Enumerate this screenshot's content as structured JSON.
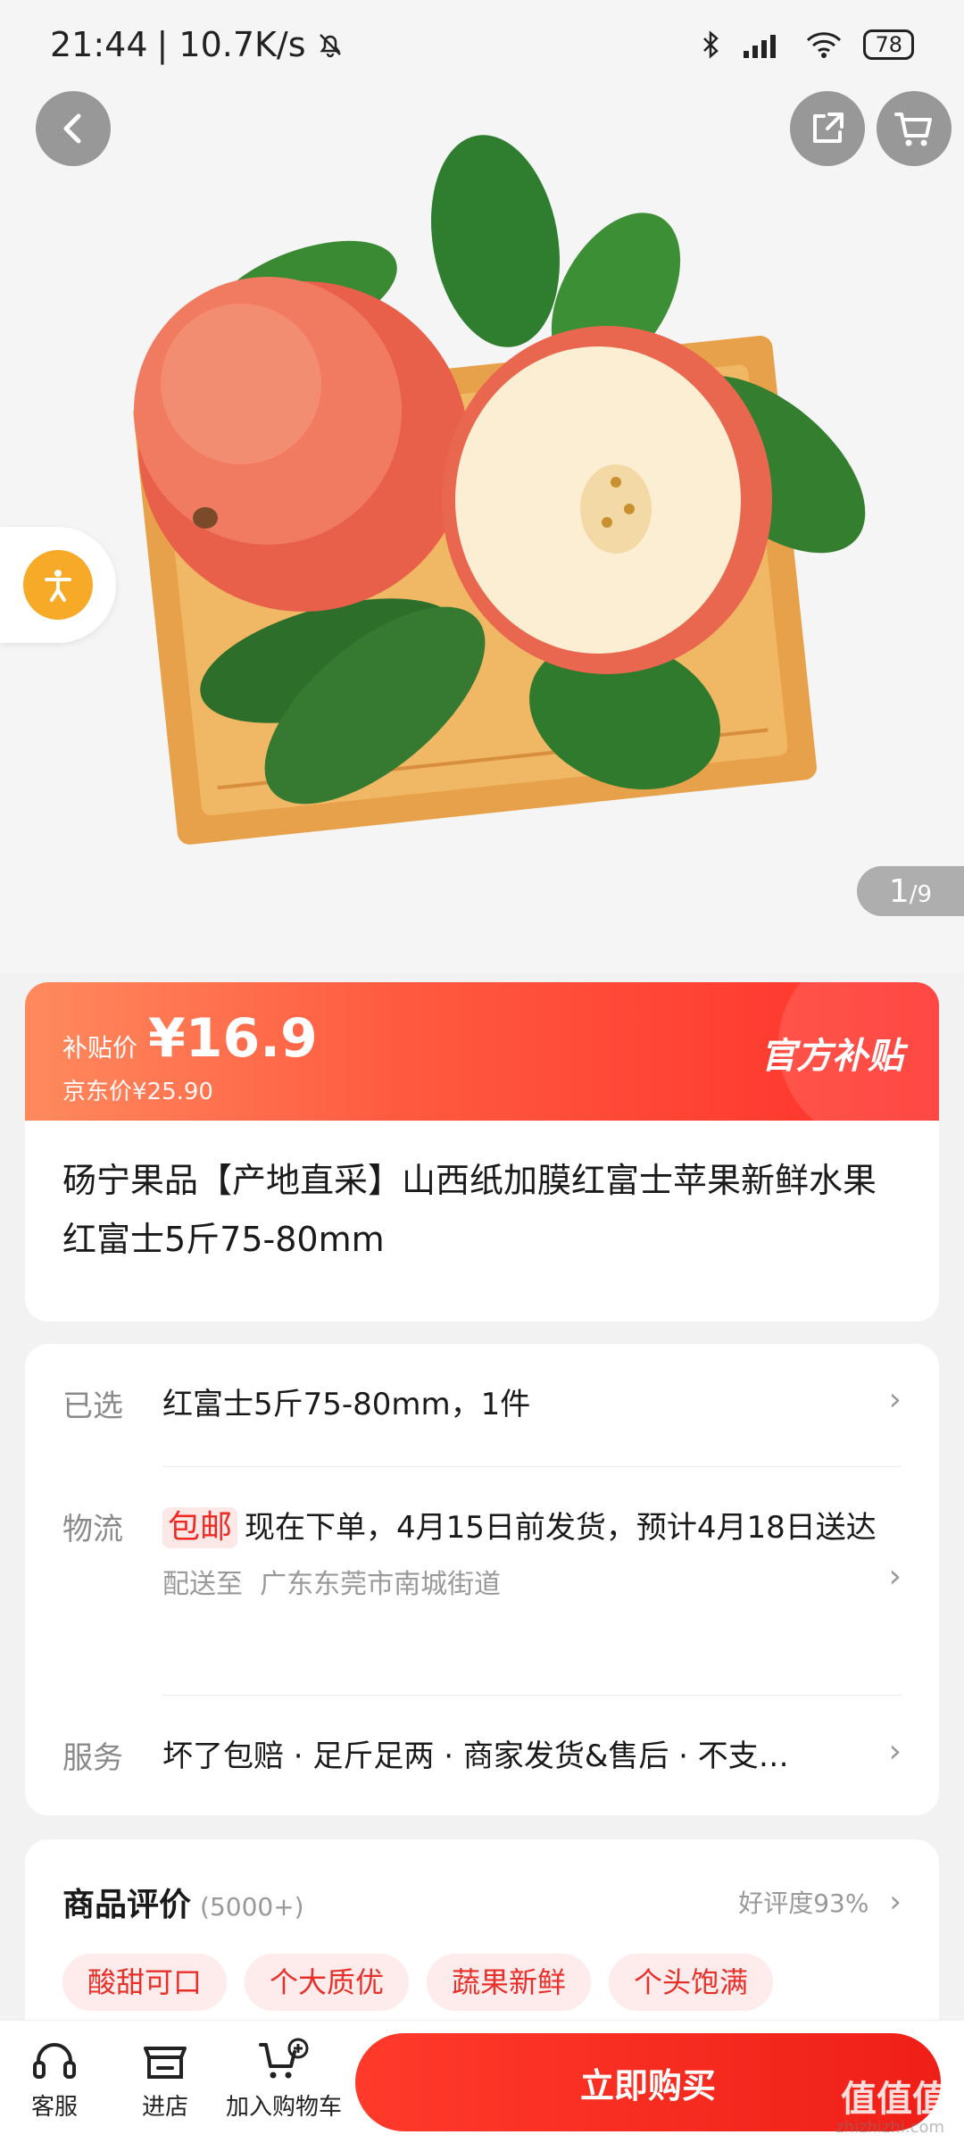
{
  "status_bar": {
    "time": "21:44",
    "net_speed": "| 10.7K/s",
    "battery": "78"
  },
  "gallery": {
    "page_current": "1",
    "page_total": "/9"
  },
  "price": {
    "subsidy_label": "补贴价",
    "subsidy_price": "¥16.9",
    "jd_price": "京东价¥25.90",
    "official_tag": "官方补贴"
  },
  "product": {
    "title": "砀宁果品【产地直采】山西纸加膜红富士苹果新鲜水果 红富士5斤75-80mm"
  },
  "options": {
    "selected_label": "已选",
    "selected_value": "红富士5斤75-80mm，1件",
    "logistics_label": "物流",
    "free_shipping_tag": "包邮",
    "logistics_value": "现在下单，4月15日前发货，预计4月18日送达",
    "deliver_to_label": "配送至",
    "deliver_to_value": "广东东莞市南城街道",
    "service_label": "服务",
    "service_value": "坏了包赔 · 足斤足两 · 商家发货&售后 · 不支…"
  },
  "reviews": {
    "title": "商品评价",
    "count": "(5000+)",
    "rating": "好评度93%",
    "tags": [
      "酸甜可口",
      "个大质优",
      "蔬果新鲜",
      "个头饱满"
    ]
  },
  "bottom_bar": {
    "service": "客服",
    "store": "进店",
    "add_cart": "加入购物车",
    "buy_now": "立即购买"
  },
  "watermark": {
    "brand": "值值值",
    "site": "zhizhizhi.com"
  }
}
